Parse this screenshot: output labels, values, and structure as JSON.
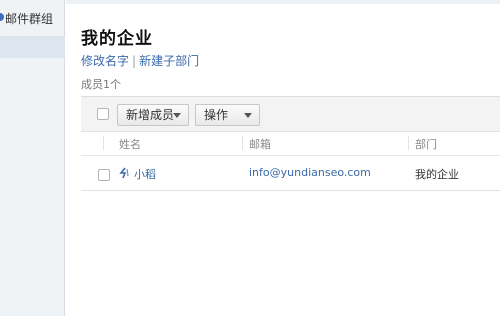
{
  "sidebar": {
    "items": [
      {
        "label": "邮件群组",
        "icon": "dot-icon"
      },
      {
        "label": ""
      }
    ]
  },
  "page": {
    "title": "我的企业",
    "links": {
      "rename": "修改名字",
      "separator": "|",
      "new_sub_department": "新建子部门"
    },
    "member_count": "成员1个"
  },
  "toolbar": {
    "add_member": "新增成员",
    "operations": "操作"
  },
  "table": {
    "columns": [
      "姓名",
      "邮箱",
      "部门"
    ],
    "rows": [
      {
        "name": "小稻",
        "email": "info@yundianseo.com",
        "department": "我的企业"
      }
    ]
  },
  "colors": {
    "link": "#3a6aa9",
    "sidebar_bg": "#f0f3f6",
    "selected_bg": "#dde5ef",
    "toolbar_bg": "#f3f3f3"
  }
}
